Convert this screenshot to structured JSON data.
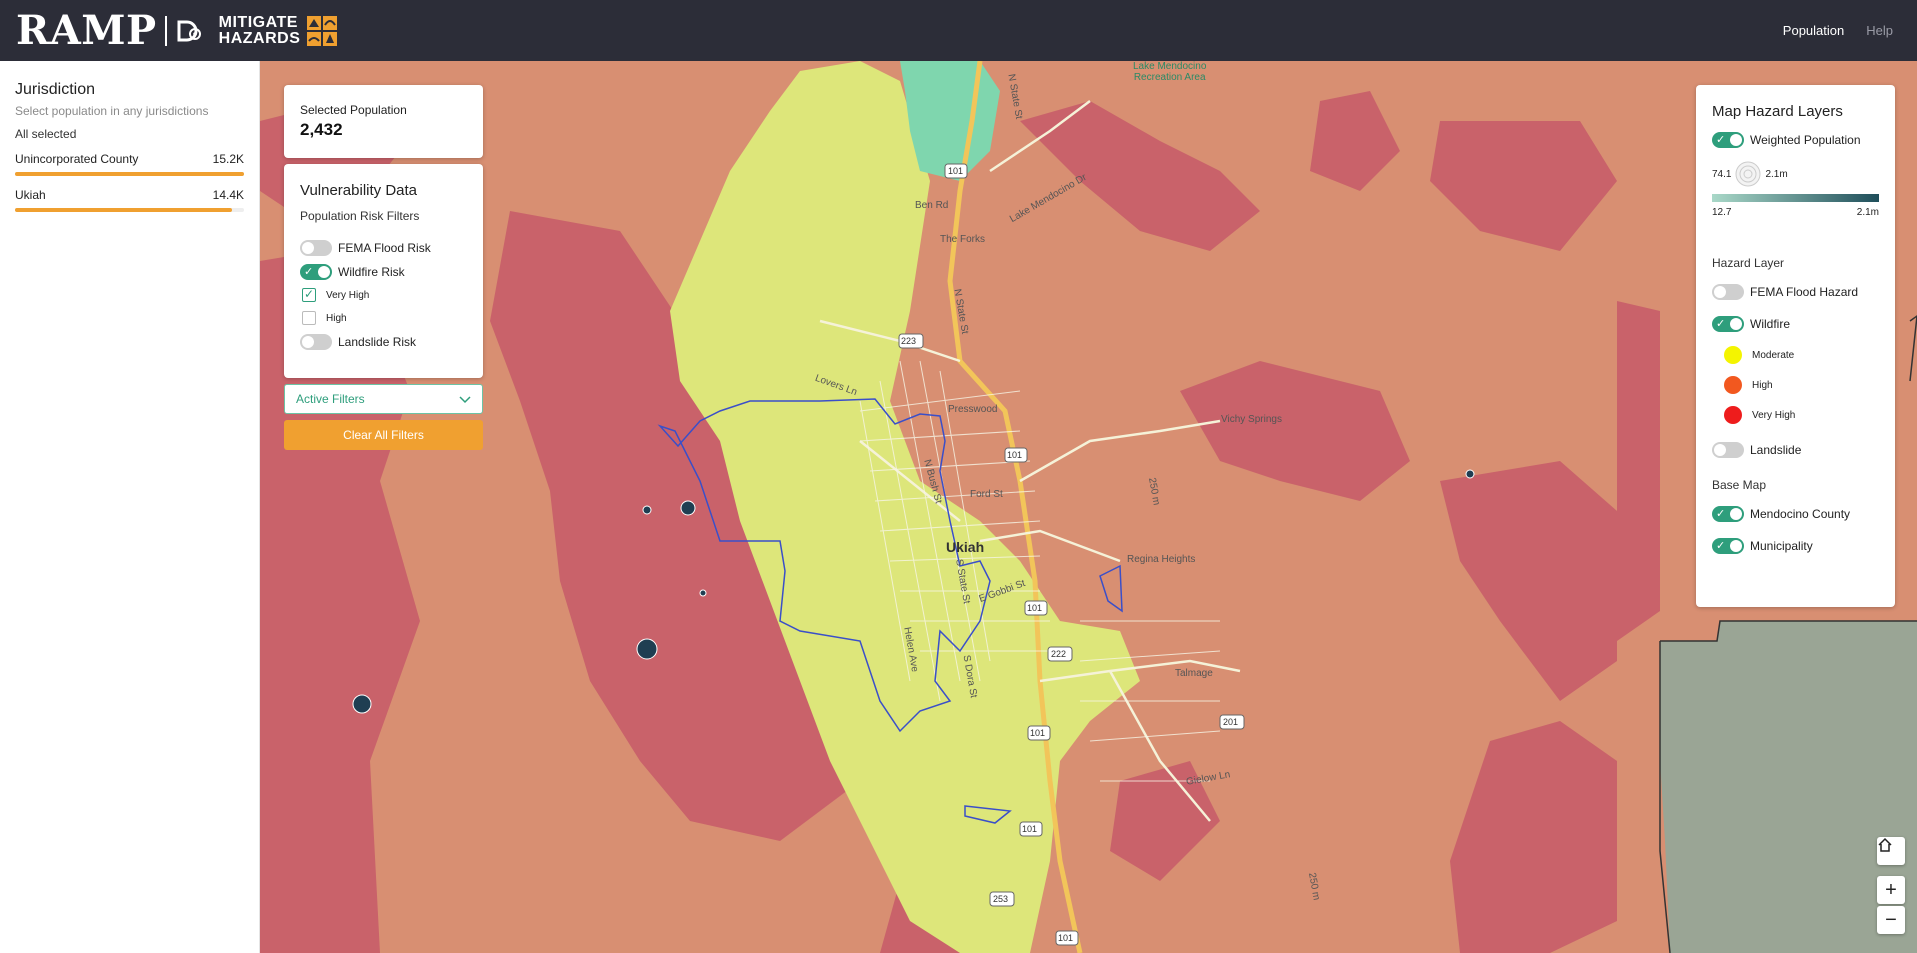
{
  "header": {
    "brand": "RAMP",
    "brand_sub_line1": "MITIGATE",
    "brand_sub_line2": "HAZARDS",
    "nav": [
      {
        "label": "Population",
        "active": true
      },
      {
        "label": "Help",
        "active": false
      }
    ]
  },
  "sidebar": {
    "title": "Jurisdiction",
    "subtitle": "Select population in any jurisdictions",
    "all_selected": "All selected",
    "items": [
      {
        "label": "Unincorporated County",
        "value": "15.2K",
        "fill": 1.0
      },
      {
        "label": "Ukiah",
        "value": "14.4K",
        "fill": 0.947
      }
    ]
  },
  "population_card": {
    "label": "Selected Population",
    "value": "2,432"
  },
  "vulnerability": {
    "title": "Vulnerability Data",
    "subtitle": "Population Risk Filters",
    "fema_flood": {
      "label": "FEMA Flood Risk",
      "on": false
    },
    "wildfire": {
      "label": "Wildfire Risk",
      "on": true
    },
    "very_high": {
      "label": "Very High",
      "checked": true
    },
    "high": {
      "label": "High",
      "checked": false
    },
    "landslide": {
      "label": "Landslide Risk",
      "on": false
    }
  },
  "active_filters": {
    "label": "Active Filters"
  },
  "clear_filters": {
    "label": "Clear All Filters"
  },
  "legend": {
    "title": "Map Hazard Layers",
    "weighted_population": {
      "label": "Weighted Population",
      "on": true
    },
    "circle_min": "74.1",
    "circle_max": "2.1m",
    "ramp_min": "12.7",
    "ramp_max": "2.1m",
    "hazard_section": "Hazard Layer",
    "fema_flood_hazard": {
      "label": "FEMA Flood Hazard",
      "on": false
    },
    "wildfire": {
      "label": "Wildfire",
      "on": true
    },
    "classes": [
      {
        "label": "Moderate",
        "color": "#f4f400"
      },
      {
        "label": "High",
        "color": "#f2581f"
      },
      {
        "label": "Very High",
        "color": "#ee1c1c"
      }
    ],
    "landslide": {
      "label": "Landslide",
      "on": false
    },
    "base_section": "Base Map",
    "mendocino": {
      "label": "Mendocino County",
      "on": true
    },
    "municipality": {
      "label": "Municipality",
      "on": true
    }
  },
  "map": {
    "labels": {
      "lake": "Lake Mendocino\nRecreation Area",
      "lake_line1": "Lake Mendocino",
      "lake_line2": "Recreation Area",
      "n_state_st": "N State St",
      "ben_rd": "Ben Rd",
      "lake_mendocino_dr": "Lake Mendocino Dr",
      "the_forks": "The Forks",
      "n_state_st_2": "N State St",
      "road_223": "223",
      "road_101": "101",
      "road_101b": "101",
      "road_101c": "101",
      "road_101d": "101",
      "road_101e": "101",
      "road_101f": "101",
      "road_222": "222",
      "road_201": "201",
      "road_253": "253",
      "lovers_ln": "Lovers Ln",
      "presswood": "Presswood",
      "n_bush_st": "N Bush St",
      "ford_st": "Ford St",
      "ukiah": "Ukiah",
      "vichy_springs": "Vichy Springs",
      "regina_heights": "Regina Heights",
      "e_gobbi_st": "E Gobbi St",
      "s_dora_st": "S Dora St",
      "helen_ave": "Helen Ave",
      "s_state_st": "S State St",
      "talmage": "Talmage",
      "gielow_ln": "Gielow Ln",
      "contour_250": "250 m",
      "contour_250b": "250 m"
    },
    "zoom_in": "+",
    "zoom_out": "−",
    "colors": {
      "wildfire_high": "#d88f72",
      "wildfire_very_high": "#c9626a",
      "moderate": "#dde67a",
      "boundary": "#3a4fc9",
      "accent": "#2e9e7c",
      "orange": "#f0a030"
    }
  }
}
